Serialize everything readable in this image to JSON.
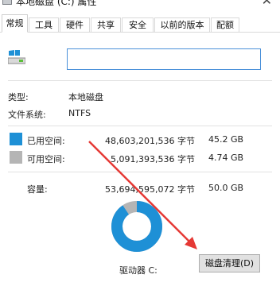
{
  "window": {
    "title": "本地磁盘 (C:) 属性",
    "close_glyph": "✕"
  },
  "tabs": [
    {
      "label": "常规",
      "active": true
    },
    {
      "label": "工具",
      "active": false
    },
    {
      "label": "硬件",
      "active": false
    },
    {
      "label": "共享",
      "active": false
    },
    {
      "label": "安全",
      "active": false
    },
    {
      "label": "以前的版本",
      "active": false
    },
    {
      "label": "配额",
      "active": false
    }
  ],
  "drive": {
    "icon": "drive-icon",
    "name_value": ""
  },
  "info": {
    "type_label": "类型:",
    "type_value": "本地磁盘",
    "fs_label": "文件系统:",
    "fs_value": "NTFS"
  },
  "space": {
    "used_label": "已用空间:",
    "used_bytes": "48,603,201,536 字节",
    "used_gb": "45.2 GB",
    "free_label": "可用空间:",
    "free_bytes": "5,091,393,536 字节",
    "free_gb": "4.74 GB",
    "capacity_label": "容量:",
    "capacity_bytes": "53,694,595,072 字节",
    "capacity_gb": "50.0 GB",
    "used_fraction": 0.905
  },
  "colors": {
    "used": "#1e90d6",
    "free": "#b5b5b5",
    "arrow": "#e53935"
  },
  "drive_letter": "驱动器 C:",
  "cleanup_button": "磁盘清理(D)"
}
